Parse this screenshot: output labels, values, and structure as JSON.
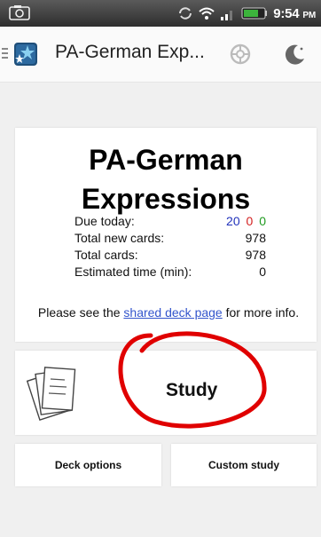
{
  "status_bar": {
    "time": "9:54",
    "ampm": "PM",
    "icons": [
      "screenshot-icon",
      "sync-status-icon",
      "wifi-icon",
      "signal-icon",
      "battery-icon"
    ]
  },
  "action_bar": {
    "title": "PA-German Exp...",
    "icons": [
      "up-caret-icon",
      "anki-logo-icon",
      "sync-icon",
      "night-mode-icon"
    ]
  },
  "deck": {
    "title": "PA-German Expressions",
    "due_label": "Due today:",
    "due_values": {
      "new": "20",
      "learning": "0",
      "review": "0"
    },
    "total_new_label": "Total new cards:",
    "total_new_value": "978",
    "total_label": "Total cards:",
    "total_value": "978",
    "est_label": "Estimated time (min):",
    "est_value": "0",
    "note_before": "Please see the ",
    "note_link": "shared deck page",
    "note_after": " for more info."
  },
  "study": {
    "label": "Study",
    "icon": "cards-icon"
  },
  "buttons": {
    "deck_options": "Deck options",
    "custom_study": "Custom study"
  },
  "colors": {
    "due_new": "#2233bb",
    "due_learning": "#d32020",
    "due_review": "#1f9a1f",
    "link": "#3355cc",
    "annotation": "#e00000"
  }
}
